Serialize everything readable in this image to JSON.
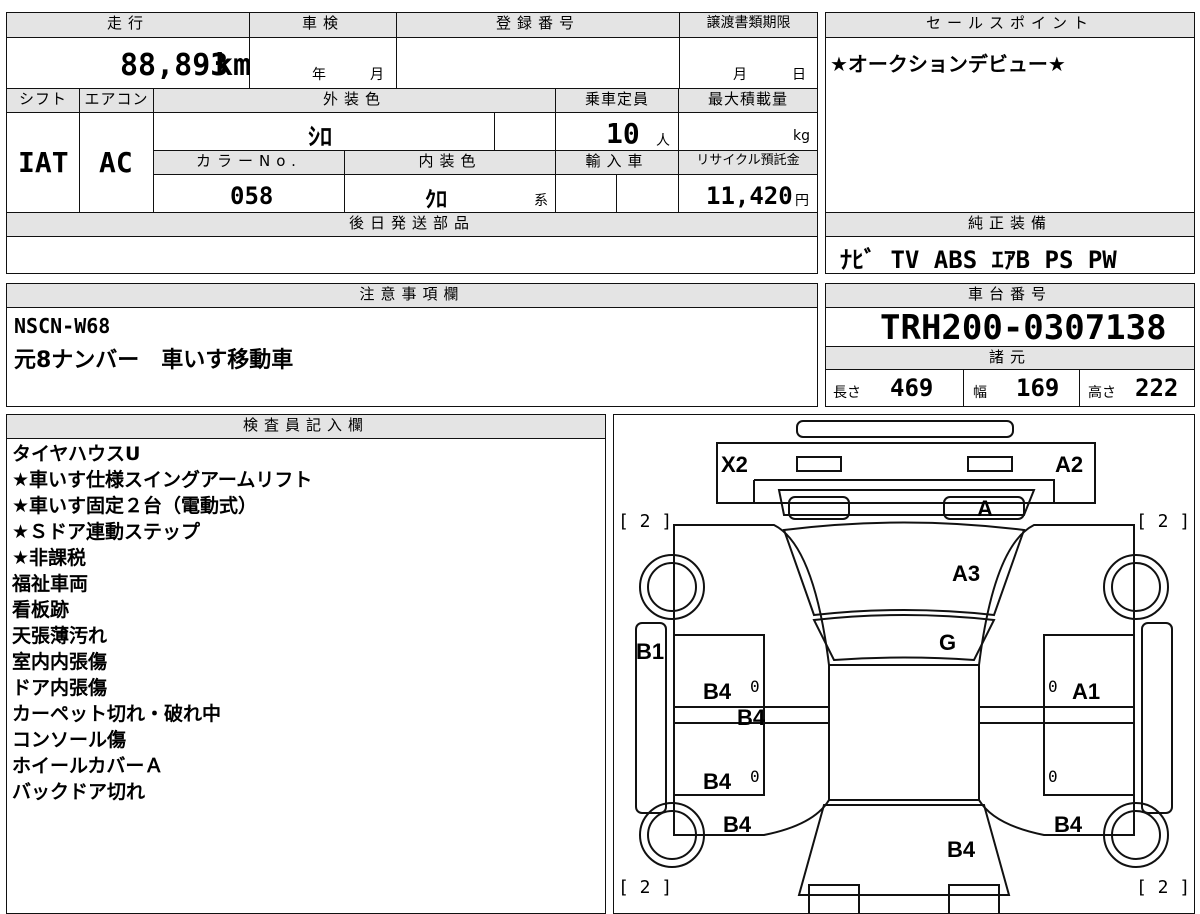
{
  "top_block": {
    "headers": {
      "mileage": "走行",
      "inspection": "車検",
      "registration": "登録番号",
      "transfer_deadline": "譲渡書類期限",
      "shift": "シフト",
      "aircon": "エアコン",
      "exterior_color": "外装色",
      "capacity": "乗車定員",
      "max_load": "最大積載量",
      "color_no": "カラーNo.",
      "interior_color": "内装色",
      "import": "輸入車",
      "recycle_fee": "リサイクル預託金",
      "later_parts": "後日発送部品"
    },
    "mileage_value": "88,893",
    "mileage_unit": "km",
    "inspection_year": "年",
    "inspection_month": "月",
    "transfer_month": "月",
    "transfer_day": "日",
    "shift_value": "IAT",
    "aircon_value": "AC",
    "exterior_color_value": "ｼﾛ",
    "capacity_value": "10",
    "capacity_unit": "人",
    "max_load_unit": "kg",
    "color_no_value": "058",
    "interior_color_value": "ｸﾛ",
    "interior_suffix": "系",
    "recycle_value": "11,420",
    "recycle_unit": "円"
  },
  "sales_point": {
    "header": "セールスポイント",
    "text": "★オークションデビュー★"
  },
  "equipment": {
    "header": "純正装備",
    "text": "ﾅﾋﾞ TV ABS ｴｱB PS PW"
  },
  "notes": {
    "header": "注意事項欄",
    "line1": "NSCN-W68",
    "line2": "元8ナンバー　車いす移動車"
  },
  "chassis": {
    "header": "車台番号",
    "value": "TRH200-0307138",
    "spec_header": "諸元",
    "length_label": "長さ",
    "length_value": "469",
    "width_label": "幅",
    "width_value": "169",
    "height_label": "高さ",
    "height_value": "222"
  },
  "inspector": {
    "header": "検査員記入欄",
    "lines": [
      "タイヤハウスU",
      "★車いす仕様スイングアームリフト",
      "★車いす固定２台（電動式）",
      "★Ｓドア連動ステップ",
      "★非課税",
      "福祉車両",
      "看板跡",
      "天張薄汚れ",
      "室内内張傷",
      "ドア内張傷",
      "カーペット切れ・破れ中",
      "コンソール傷",
      "ホイールカバーＡ",
      "バックドア切れ"
    ]
  },
  "diagram": {
    "labels": {
      "x2": "X2",
      "a2": "A2",
      "a": "A",
      "a3": "A3",
      "g": "G",
      "b1": "B1",
      "a1": "A1",
      "b4_left_upper": "B4",
      "b4_center": "B4",
      "b4_left_lower": "B4",
      "b4_front_left": "B4",
      "b4_front_right": "B4",
      "b4_rear": "B4",
      "tire_tl": "[ 2 ]",
      "tire_tr": "[ 2 ]",
      "tire_bl": "[ 2 ]",
      "tire_br": "[ 2 ]",
      "zero_1": "0",
      "zero_2": "0",
      "zero_3": "0",
      "zero_4": "0"
    }
  }
}
